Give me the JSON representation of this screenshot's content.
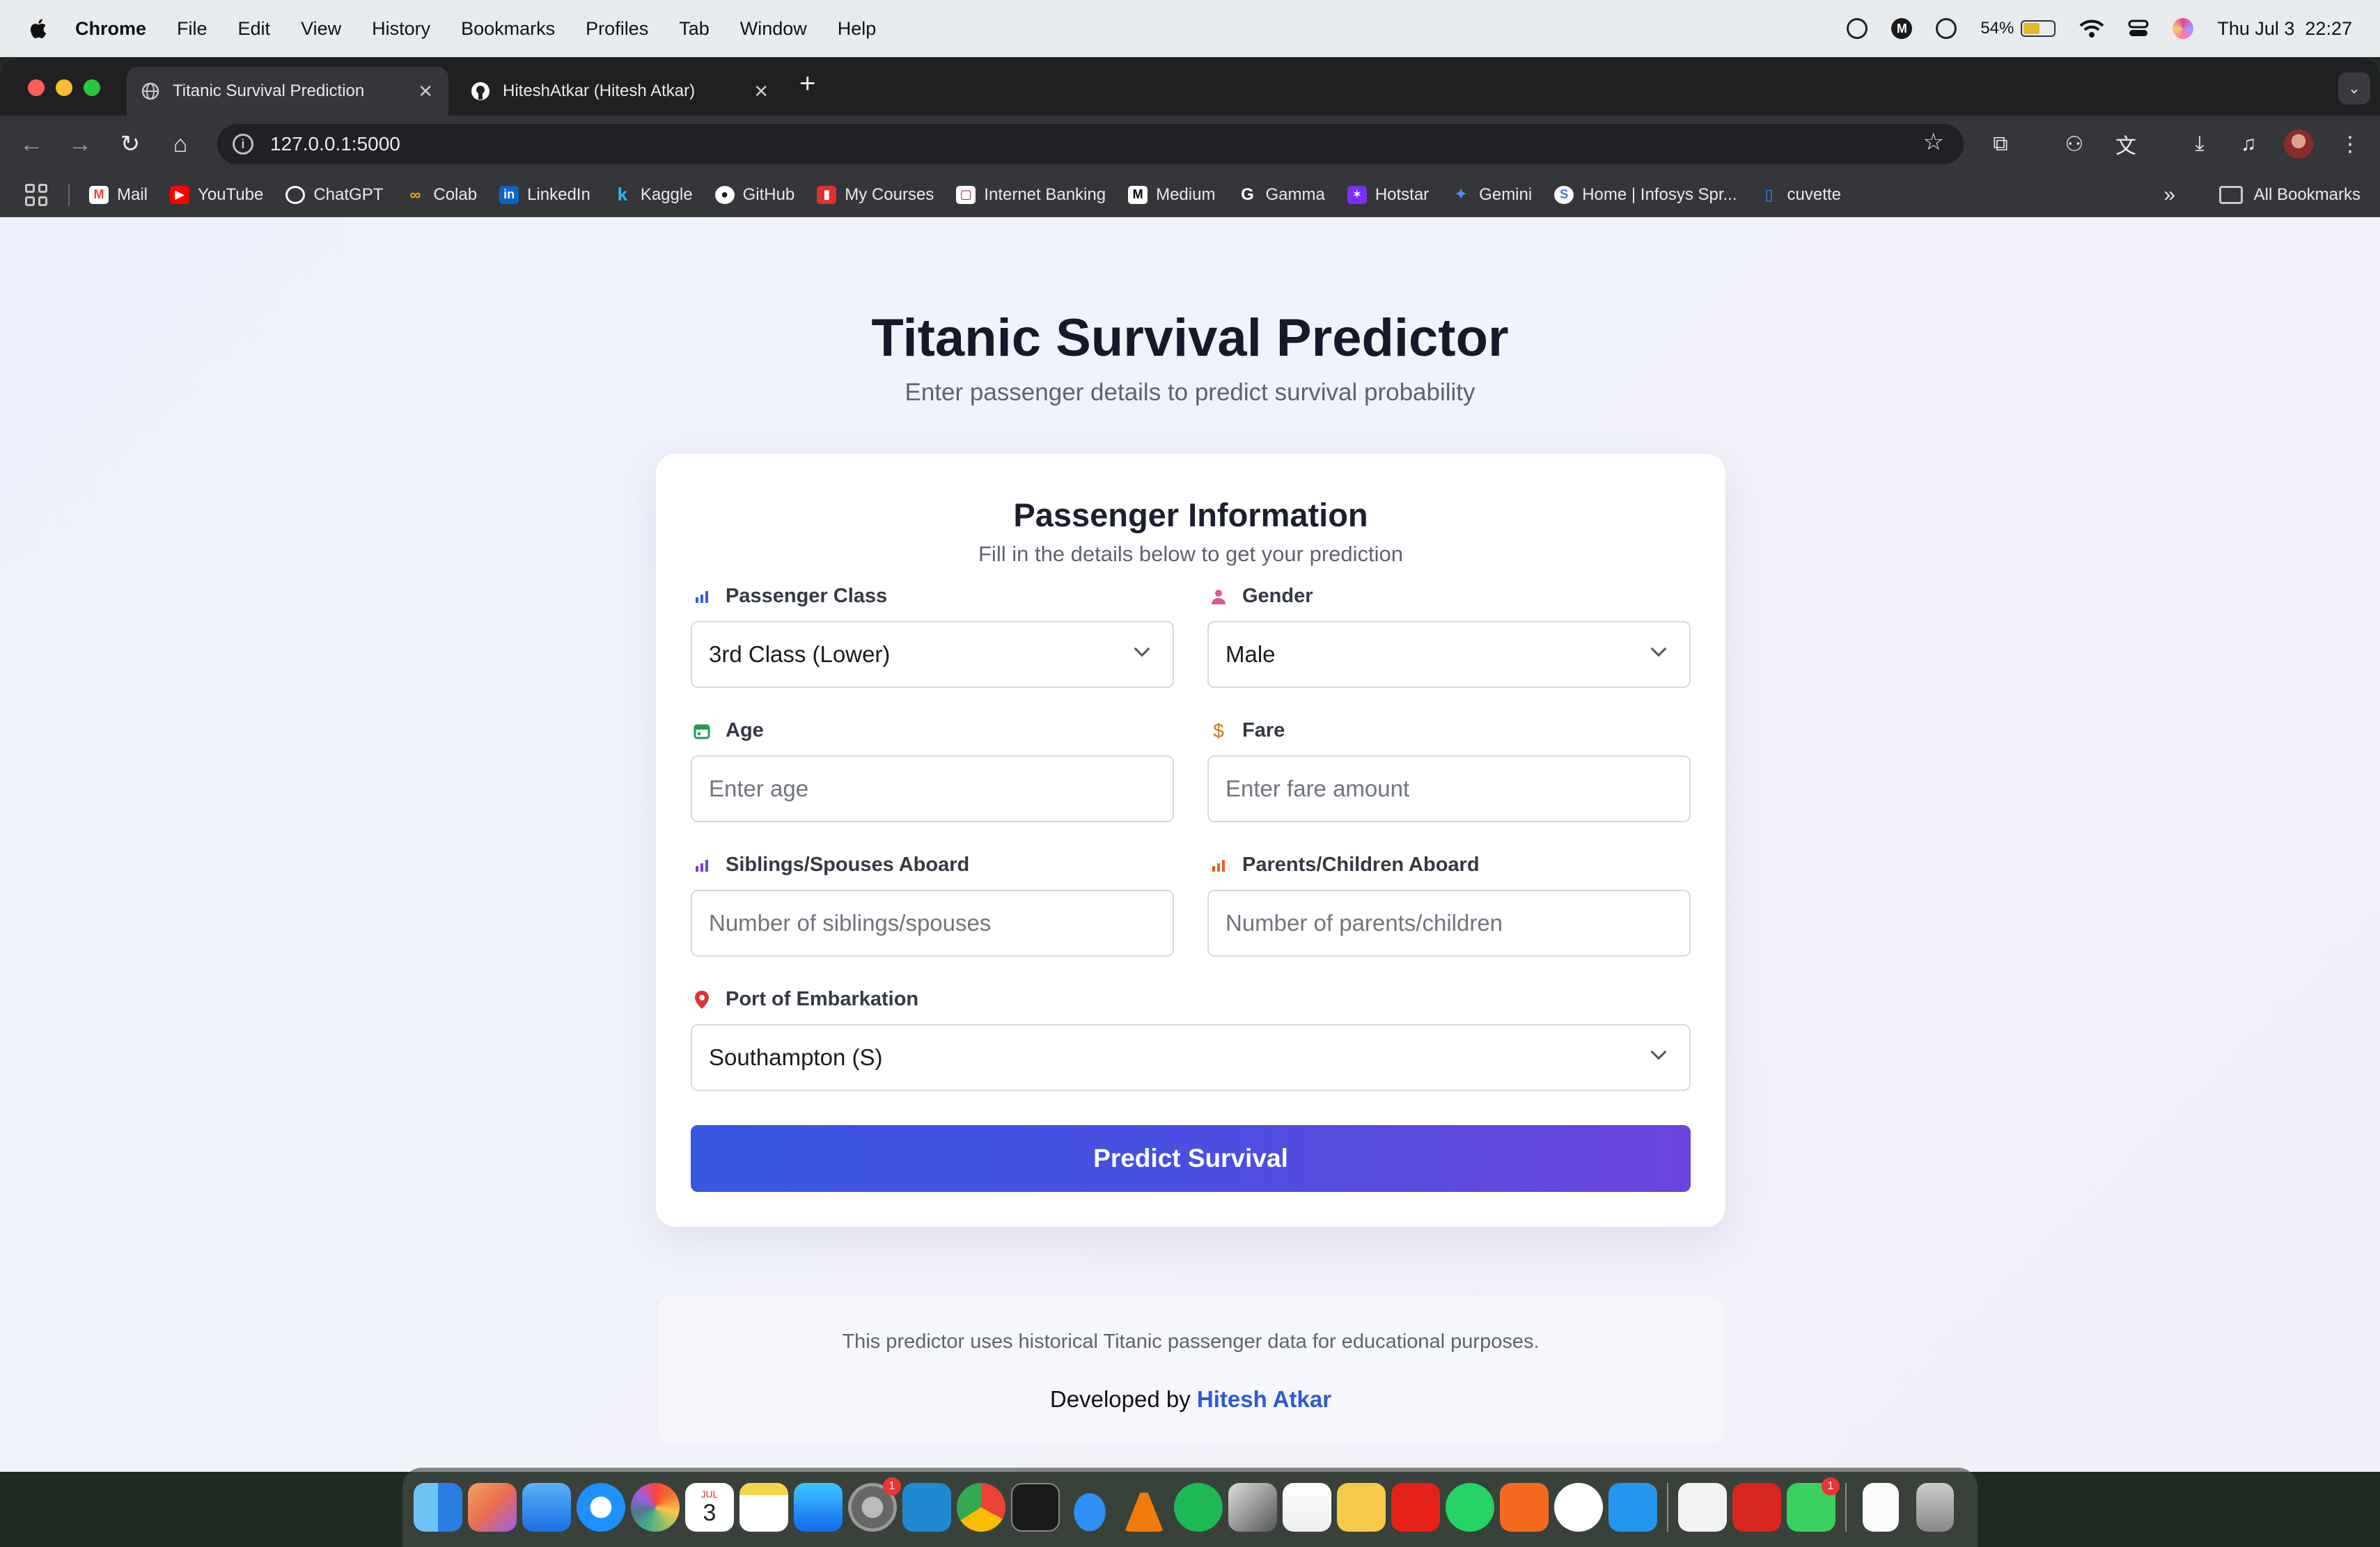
{
  "menubar": {
    "items": [
      "Chrome",
      "File",
      "Edit",
      "View",
      "History",
      "Bookmarks",
      "Profiles",
      "Tab",
      "Window",
      "Help"
    ],
    "battery": "54%",
    "battery_level": 0.54,
    "datetime": "Thu Jul 3  22:27"
  },
  "browser": {
    "tabs": [
      {
        "title": "Titanic Survival Prediction",
        "icon": "globe-icon"
      },
      {
        "title": "HiteshAtkar (Hitesh Atkar)",
        "icon": "github-icon"
      }
    ],
    "url": "127.0.0.1:5000",
    "bookmarks": [
      {
        "label": "Mail",
        "icon": "gmail-icon",
        "color": "#ea4335"
      },
      {
        "label": "YouTube",
        "icon": "youtube-icon",
        "color": "#ff0000"
      },
      {
        "label": "ChatGPT",
        "icon": "chatgpt-icon",
        "color": "#ffffff"
      },
      {
        "label": "Colab",
        "icon": "colab-icon",
        "color": "#f9ab00"
      },
      {
        "label": "LinkedIn",
        "icon": "linkedin-icon",
        "color": "#0a66c2"
      },
      {
        "label": "Kaggle",
        "icon": "kaggle-icon",
        "color": "#20beff"
      },
      {
        "label": "GitHub",
        "icon": "github-icon",
        "color": "#ffffff"
      },
      {
        "label": "My Courses",
        "icon": "courses-icon",
        "color": "#e0302a"
      },
      {
        "label": "Internet Banking",
        "icon": "bank-icon",
        "color": "#97144d"
      },
      {
        "label": "Medium",
        "icon": "medium-icon",
        "color": "#ffffff"
      },
      {
        "label": "Gamma",
        "icon": "google-icon",
        "color": "#ffffff"
      },
      {
        "label": "Hotstar",
        "icon": "hotstar-icon",
        "color": "#7b2ff7"
      },
      {
        "label": "Gemini",
        "icon": "gemini-icon",
        "color": "#4f8df7"
      },
      {
        "label": "Home | Infosys Spr...",
        "icon": "infosys-icon",
        "color": "#4c6ef5"
      },
      {
        "label": "cuvette",
        "icon": "cuvette-icon",
        "color": "#3b82f6"
      }
    ],
    "all_bookmarks": "All Bookmarks"
  },
  "page": {
    "title": "Titanic Survival Predictor",
    "subtitle": "Enter passenger details to predict survival probability",
    "card_title": "Passenger Information",
    "card_subtitle": "Fill in the details below to get your prediction",
    "fields": {
      "pclass": {
        "label": "Passenger Class",
        "value": "3rd Class (Lower)",
        "icon": "chart-icon",
        "icon_color": "#3b5bdb"
      },
      "gender": {
        "label": "Gender",
        "value": "Male",
        "icon": "person-icon",
        "icon_color": "#e0559a"
      },
      "age": {
        "label": "Age",
        "placeholder": "Enter age",
        "icon": "calendar-icon",
        "icon_color": "#1f9d55"
      },
      "fare": {
        "label": "Fare",
        "placeholder": "Enter fare amount",
        "icon": "dollar-icon",
        "icon_color": "#c77d1a"
      },
      "sibsp": {
        "label": "Siblings/Spouses Aboard",
        "placeholder": "Number of siblings/spouses",
        "icon": "chart-icon",
        "icon_color": "#7a3fe0"
      },
      "parch": {
        "label": "Parents/Children Aboard",
        "placeholder": "Number of parents/children",
        "icon": "chart-icon",
        "icon_color": "#e0651f"
      },
      "embarked": {
        "label": "Port of Embarkation",
        "value": "Southampton (S)",
        "icon": "location-pin-icon",
        "icon_color": "#e03131"
      }
    },
    "submit_label": "Predict Survival",
    "footer_note": "This predictor uses historical Titanic passenger data for educational purposes.",
    "footer_dev_prefix": "Developed by ",
    "footer_dev_name": "Hitesh Atkar",
    "accent": "#3757df"
  },
  "dock": {
    "apps": [
      "finder",
      "launchpad",
      "mail",
      "safari",
      "photos",
      "calendar",
      "notes",
      "app-store",
      "system-settings",
      "vscode",
      "chrome",
      "terminal",
      "onedrive",
      "vlc",
      "spotify",
      "sidecar",
      "home",
      "notes-yellow",
      "youtube",
      "whatsapp",
      "sketch",
      "chatgpt",
      "docker",
      "textedit",
      "acrobat",
      "facetime",
      "file",
      "trash"
    ],
    "calendar_month": "JUL",
    "calendar_day": "3",
    "badges": {
      "system-settings": "1",
      "facetime": "1"
    }
  }
}
